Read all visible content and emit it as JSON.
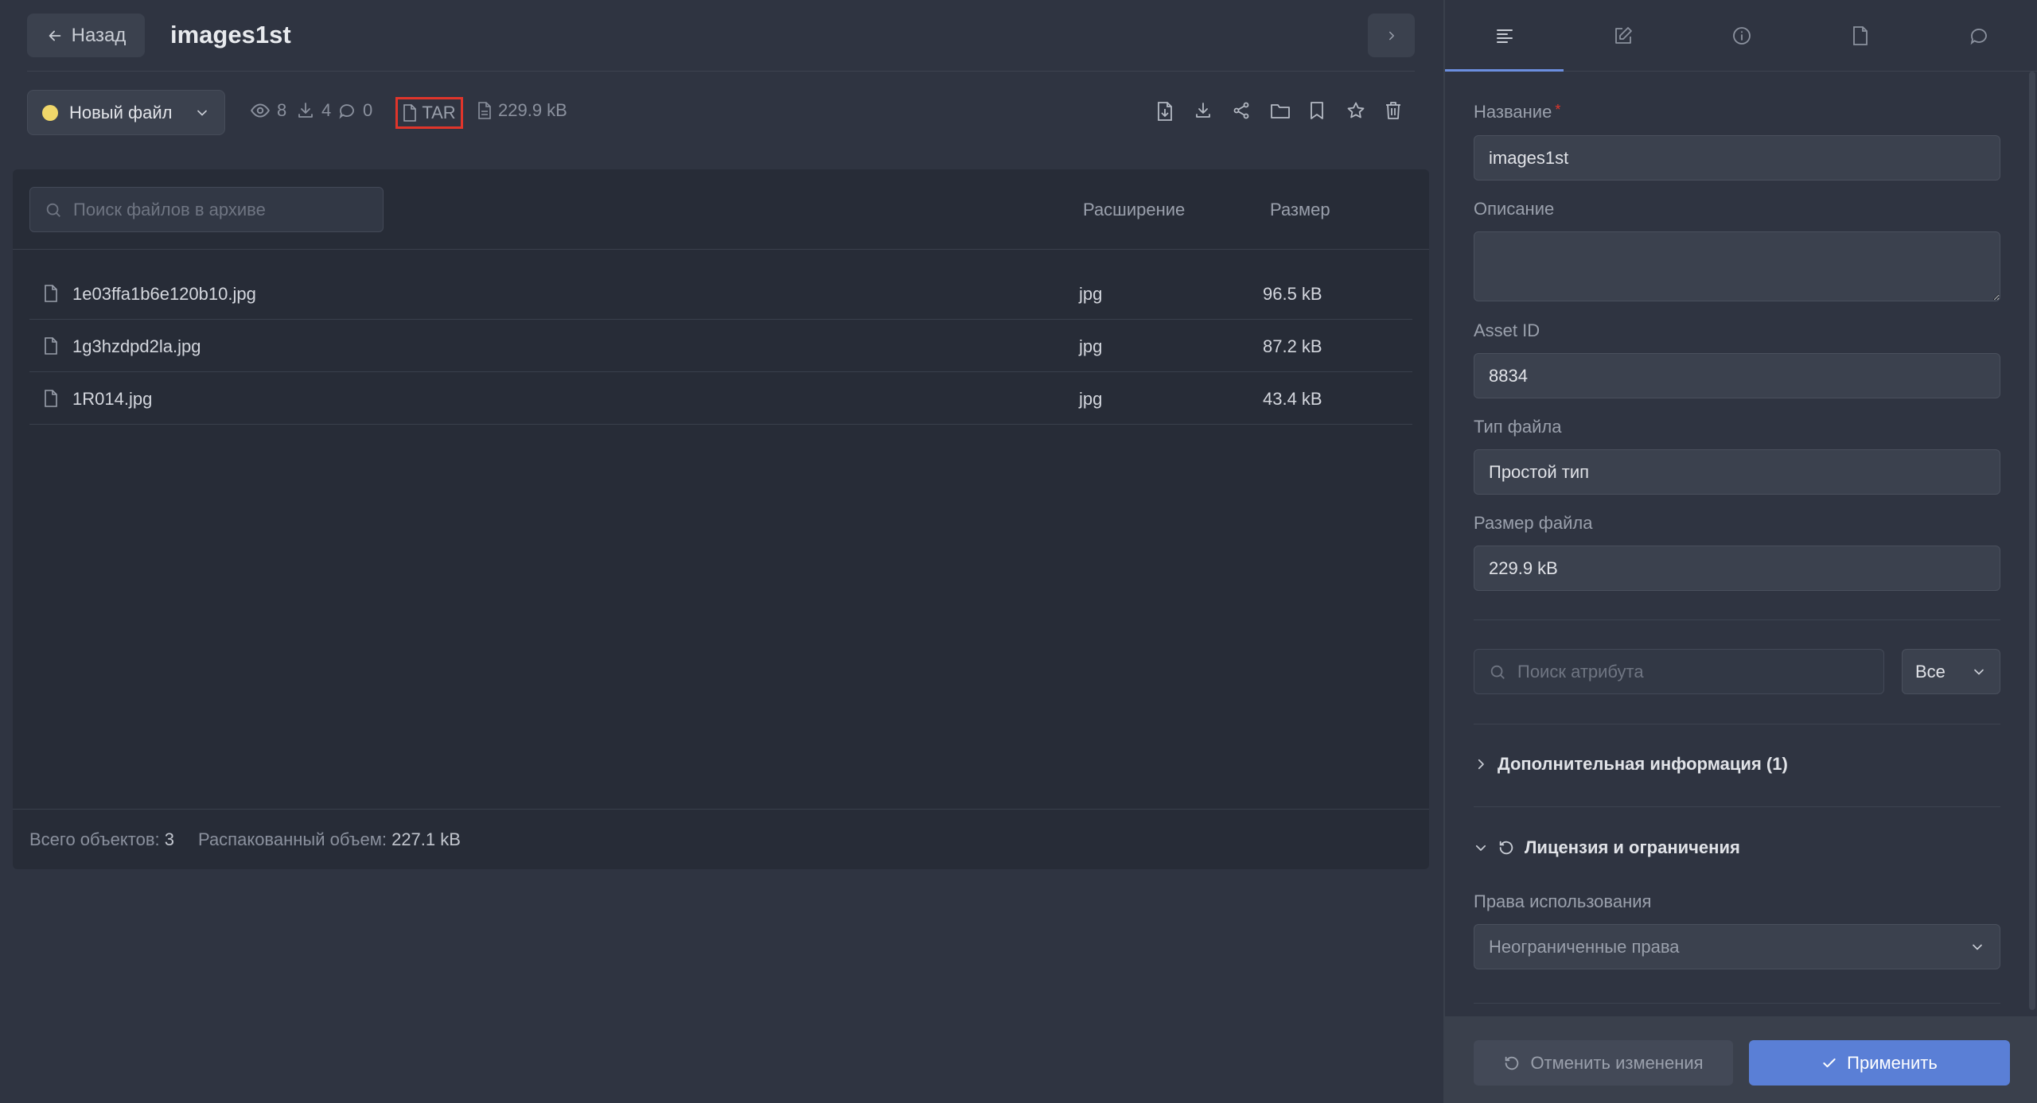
{
  "header": {
    "back_label": "Назад",
    "title": "images1st"
  },
  "toolbar": {
    "status_label": "Новый файл",
    "status_color": "#f0d76a",
    "views": "8",
    "downloads": "4",
    "comments": "0",
    "format": "TAR",
    "size": "229.9 kB",
    "actions": [
      "file-export-icon",
      "download-icon",
      "share-icon",
      "folder-icon",
      "bookmark-icon",
      "star-icon",
      "trash-icon"
    ]
  },
  "archive": {
    "search_placeholder": "Поиск файлов в архиве",
    "col_extension": "Расширение",
    "col_size": "Размер",
    "files": [
      {
        "name": "1e03ffa1b6e120b10.jpg",
        "ext": "jpg",
        "size": "96.5 kB"
      },
      {
        "name": "1g3hzdpd2la.jpg",
        "ext": "jpg",
        "size": "87.2 kB"
      },
      {
        "name": "1R014.jpg",
        "ext": "jpg",
        "size": "43.4 kB"
      }
    ],
    "footer": {
      "total_label": "Всего объектов:",
      "total_value": "3",
      "unpacked_label": "Распакованный объем:",
      "unpacked_value": "227.1 kB"
    }
  },
  "panel": {
    "tabs": [
      "list-icon",
      "edit-icon",
      "info-icon",
      "document-icon",
      "comment-icon"
    ],
    "name_label": "Название",
    "name_value": "images1st",
    "description_label": "Описание",
    "description_value": "",
    "asset_id_label": "Asset ID",
    "asset_id_value": "8834",
    "file_type_label": "Тип файла",
    "file_type_value": "Простой тип",
    "file_size_label": "Размер файла",
    "file_size_value": "229.9 kB",
    "attr_search_placeholder": "Поиск атрибута",
    "attr_filter_value": "Все",
    "extra_info_label": "Дополнительная информация (1)",
    "license_label": "Лицензия и ограничения",
    "usage_rights_label": "Права использования",
    "usage_rights_value": "Неограниченные права",
    "cancel_label": "Отменить изменения",
    "apply_label": "Применить",
    "accent_color": "#5a7fd6"
  }
}
